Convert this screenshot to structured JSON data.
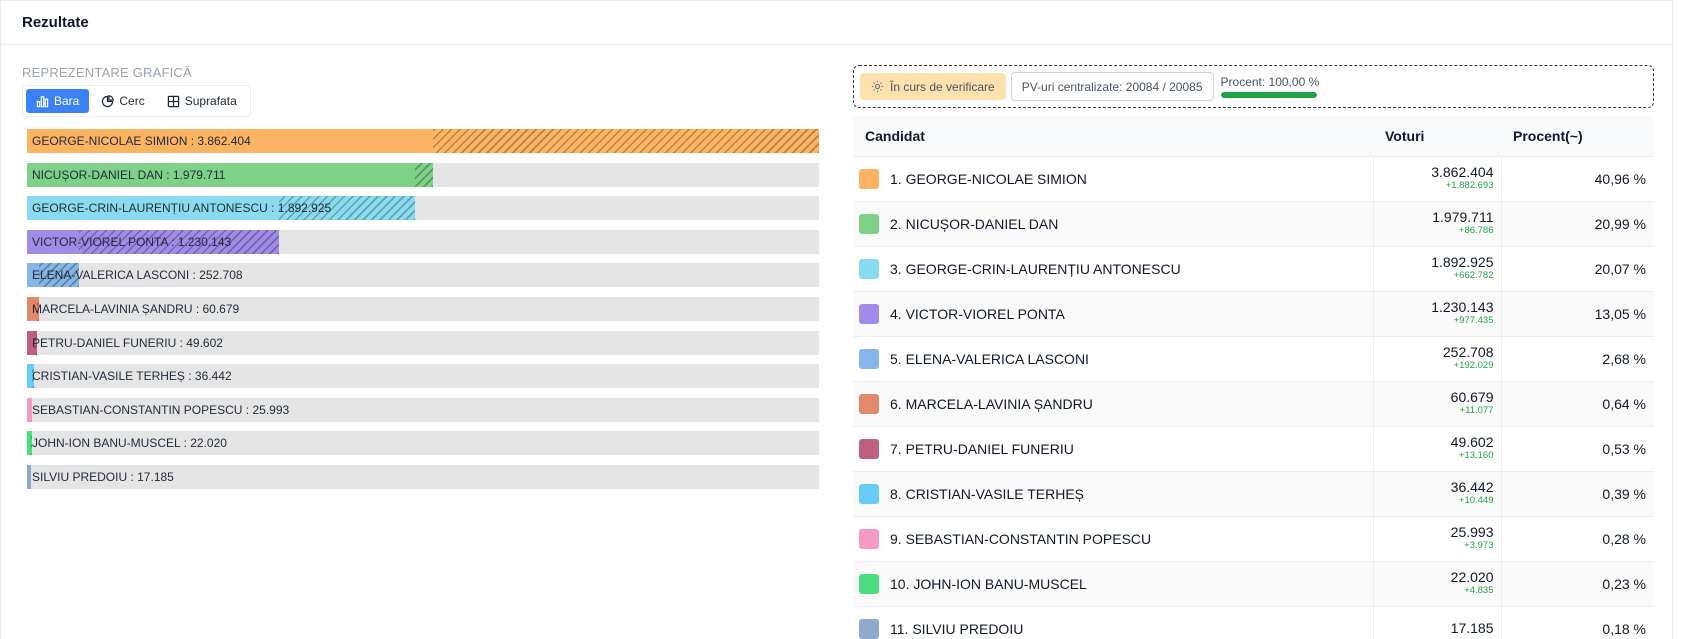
{
  "header": {
    "title": "Rezultate"
  },
  "chart_section": {
    "label": "REPREZENTARE GRAFICĂ",
    "view_toggle": [
      {
        "label": "Bara",
        "icon": "bar-chart-icon",
        "active": true
      },
      {
        "label": "Cerc",
        "icon": "pie-chart-icon",
        "active": false
      },
      {
        "label": "Suprafata",
        "icon": "area-chart-icon",
        "active": false
      }
    ]
  },
  "status": {
    "verification_label": "În curs de verificare",
    "verification_icon": "gear-check-icon",
    "pv_label": "PV-uri centralizate: 20084 / 20085",
    "procent_label": "Procent: 100,00 %",
    "procent_value": 100,
    "procent_color": "#22a34a"
  },
  "table": {
    "headers": {
      "candidate": "Candidat",
      "votes": "Voturi",
      "percent": "Procent(~)"
    },
    "rows": [
      {
        "rank": "1.",
        "name": "GEORGE-NICOLAE SIMION",
        "votes": "3.862.404",
        "delta": "+1.882.693",
        "percent": "40,96 %",
        "color": "#fdb462"
      },
      {
        "rank": "2.",
        "name": "NICUȘOR-DANIEL DAN",
        "votes": "1.979.711",
        "delta": "+86.786",
        "percent": "20,99 %",
        "color": "#7fd18a"
      },
      {
        "rank": "3.",
        "name": "GEORGE-CRIN-LAURENȚIU ANTONESCU",
        "votes": "1.892.925",
        "delta": "+662.782",
        "percent": "20,07 %",
        "color": "#89dcef"
      },
      {
        "rank": "4.",
        "name": "VICTOR-VIOREL PONTA",
        "votes": "1.230.143",
        "delta": "+977.435",
        "percent": "13,05 %",
        "color": "#a18be8"
      },
      {
        "rank": "5.",
        "name": "ELENA-VALERICA LASCONI",
        "votes": "252.708",
        "delta": "+192.029",
        "percent": "2,68 %",
        "color": "#86b6e8"
      },
      {
        "rank": "6.",
        "name": "MARCELA-LAVINIA ȘANDRU",
        "votes": "60.679",
        "delta": "+11.077",
        "percent": "0,64 %",
        "color": "#e2886b"
      },
      {
        "rank": "7.",
        "name": "PETRU-DANIEL FUNERIU",
        "votes": "49.602",
        "delta": "+13.160",
        "percent": "0,53 %",
        "color": "#c0607f"
      },
      {
        "rank": "8.",
        "name": "CRISTIAN-VASILE TERHEȘ",
        "votes": "36.442",
        "delta": "+10.449",
        "percent": "0,39 %",
        "color": "#67ccf6"
      },
      {
        "rank": "9.",
        "name": "SEBASTIAN-CONSTANTIN POPESCU",
        "votes": "25.993",
        "delta": "+3.973",
        "percent": "0,28 %",
        "color": "#f49ac4"
      },
      {
        "rank": "10.",
        "name": "JOHN-ION BANU-MUSCEL",
        "votes": "22.020",
        "delta": "+4.835",
        "percent": "0,23 %",
        "color": "#4ade80"
      },
      {
        "rank": "11.",
        "name": "SILVIU PREDOIU",
        "votes": "17.185",
        "delta": "",
        "percent": "0,18 %",
        "color": "#8fa9cf"
      }
    ]
  },
  "chart_data": {
    "type": "bar",
    "orientation": "horizontal",
    "xlim": [
      0,
      3862404
    ],
    "categories": [
      "GEORGE-NICOLAE SIMION",
      "NICUȘOR-DANIEL DAN",
      "GEORGE-CRIN-LAURENȚIU ANTONESCU",
      "VICTOR-VIOREL PONTA",
      "ELENA-VALERICA LASCONI",
      "MARCELA-LAVINIA ȘANDRU",
      "PETRU-DANIEL FUNERIU",
      "CRISTIAN-VASILE TERHEȘ",
      "SEBASTIAN-CONSTANTIN POPESCU",
      "JOHN-ION BANU-MUSCEL",
      "SILVIU PREDOIU"
    ],
    "labels": [
      "GEORGE-NICOLAE SIMION : 3.862.404",
      "NICUȘOR-DANIEL DAN : 1.979.711",
      "GEORGE-CRIN-LAURENȚIU ANTONESCU : 1.892.925",
      "VICTOR-VIOREL PONTA : 1.230.143",
      "ELENA-VALERICA LASCONI : 252.708",
      "MARCELA-LAVINIA ȘANDRU : 60.679",
      "PETRU-DANIEL FUNERIU : 49.602",
      "CRISTIAN-VASILE TERHEȘ : 36.442",
      "SEBASTIAN-CONSTANTIN POPESCU : 25.993",
      "JOHN-ION BANU-MUSCEL : 22.020",
      "SILVIU PREDOIU : 17.185"
    ],
    "values": [
      3862404,
      1979711,
      1892925,
      1230143,
      252708,
      60679,
      49602,
      36442,
      25993,
      22020,
      17185
    ],
    "increments": [
      1882693,
      86786,
      662782,
      977435,
      192029,
      11077,
      13160,
      10449,
      3973,
      4835,
      0
    ],
    "colors": [
      "#fdb462",
      "#7fd18a",
      "#89dcef",
      "#a18be8",
      "#86b6e8",
      "#e2886b",
      "#c0607f",
      "#67ccf6",
      "#f49ac4",
      "#4ade80",
      "#8fa9cf"
    ]
  }
}
